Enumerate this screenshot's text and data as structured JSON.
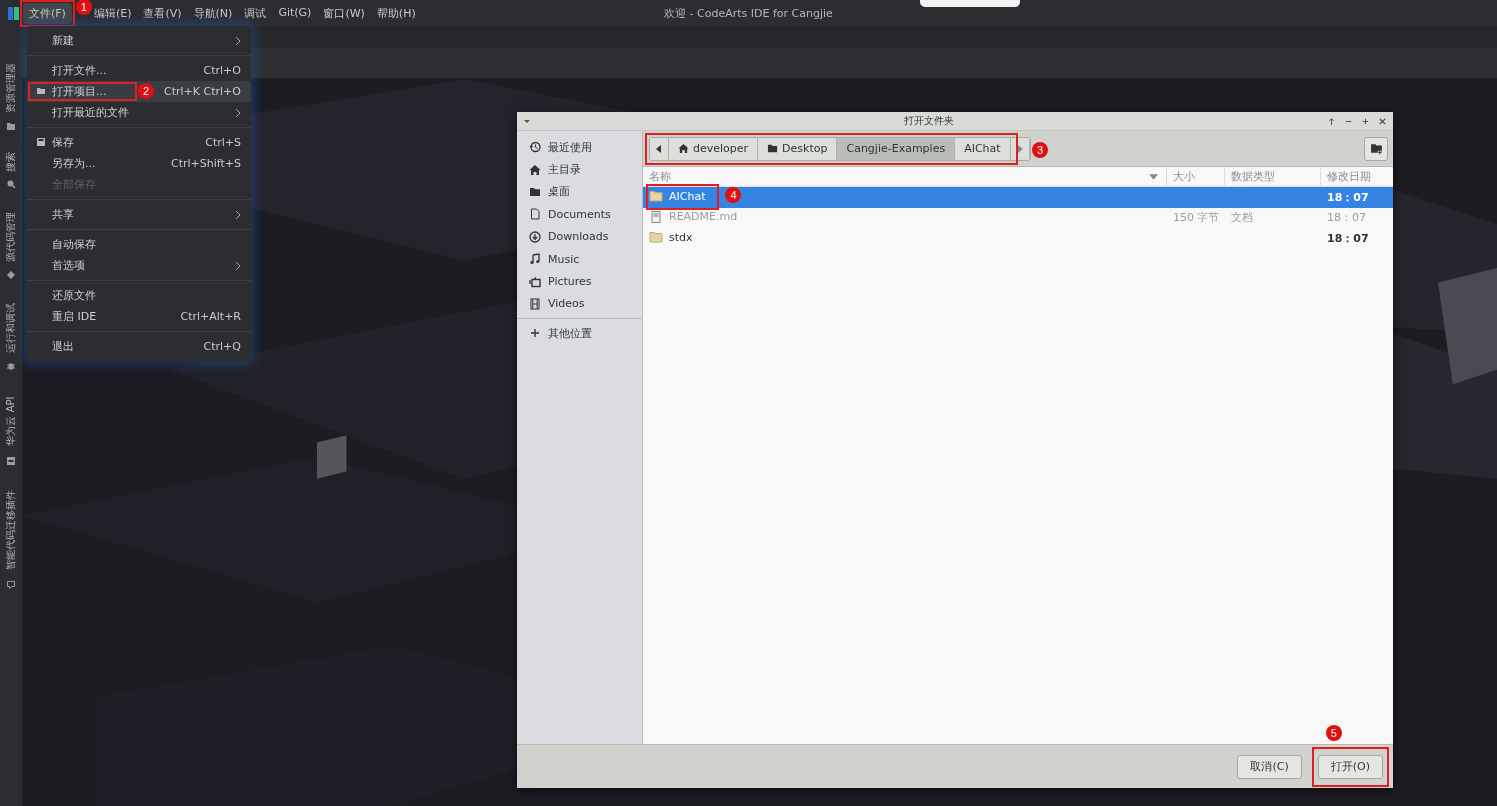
{
  "title_bar": {
    "title": "欢迎 - CodeArts IDE for Cangjie"
  },
  "menu_bar": [
    {
      "label": "文件(F)",
      "selected": true,
      "marker": "1"
    },
    {
      "label": "编辑(E)",
      "selected": false
    },
    {
      "label": "查看(V)",
      "selected": false
    },
    {
      "label": "导航(N)",
      "selected": false
    },
    {
      "label": "调试",
      "selected": false
    },
    {
      "label": "Git(G)",
      "selected": false
    },
    {
      "label": "窗口(W)",
      "selected": false
    },
    {
      "label": "帮助(H)",
      "selected": false
    }
  ],
  "activity_bar": [
    {
      "kind": "explorer",
      "label": "资源管理器"
    },
    {
      "kind": "search",
      "label": "搜索"
    },
    {
      "kind": "source",
      "label": "源代码管理"
    },
    {
      "kind": "debug",
      "label": "运行和调试"
    },
    {
      "kind": "api",
      "label": "华为云 API"
    },
    {
      "kind": "migrate",
      "label": "智能代码迁移插件"
    }
  ],
  "file_menu": [
    {
      "kind": "plain",
      "label": "新建",
      "submenu": true,
      "disabled": false,
      "selected": false
    },
    {
      "kind": "separator"
    },
    {
      "kind": "plain",
      "label": "打开文件...",
      "shortcut": "Ctrl+O",
      "submenu": false,
      "disabled": false,
      "selected": false
    },
    {
      "kind": "folder",
      "label": "打开项目...",
      "shortcut": "Ctrl+K Ctrl+O",
      "submenu": false,
      "disabled": false,
      "selected": true,
      "marker": "2"
    },
    {
      "kind": "plain",
      "label": "打开最近的文件",
      "submenu": true,
      "disabled": false,
      "selected": false
    },
    {
      "kind": "separator"
    },
    {
      "kind": "save",
      "label": "保存",
      "shortcut": "Ctrl+S",
      "submenu": false,
      "disabled": false,
      "selected": false
    },
    {
      "kind": "plain",
      "label": "另存为...",
      "shortcut": "Ctrl+Shift+S",
      "submenu": false,
      "disabled": false,
      "selected": false
    },
    {
      "kind": "plain",
      "label": "全部保存",
      "submenu": false,
      "disabled": true,
      "selected": false
    },
    {
      "kind": "separator"
    },
    {
      "kind": "plain",
      "label": "共享",
      "submenu": true,
      "disabled": false,
      "selected": false
    },
    {
      "kind": "separator"
    },
    {
      "kind": "plain",
      "label": "自动保存",
      "submenu": false,
      "disabled": false,
      "selected": false
    },
    {
      "kind": "plain",
      "label": "首选项",
      "submenu": true,
      "disabled": false,
      "selected": false
    },
    {
      "kind": "separator"
    },
    {
      "kind": "plain",
      "label": "还原文件",
      "submenu": false,
      "disabled": false,
      "selected": false
    },
    {
      "kind": "plain",
      "label": "重启 IDE",
      "shortcut": "Ctrl+Alt+R",
      "submenu": false,
      "disabled": false,
      "selected": false
    },
    {
      "kind": "separator"
    },
    {
      "kind": "plain",
      "label": "退出",
      "shortcut": "Ctrl+Q",
      "submenu": false,
      "disabled": false,
      "selected": false
    }
  ],
  "dialog": {
    "title": "打开文件夹",
    "places": [
      {
        "kind": "recent",
        "label": "最近使用"
      },
      {
        "kind": "home",
        "label": "主目录"
      },
      {
        "kind": "desktop",
        "label": "桌面"
      },
      {
        "kind": "documents",
        "label": "Documents"
      },
      {
        "kind": "downloads",
        "label": "Downloads"
      },
      {
        "kind": "music",
        "label": "Music"
      },
      {
        "kind": "pictures",
        "label": "Pictures"
      },
      {
        "kind": "videos",
        "label": "Videos"
      },
      {
        "kind": "other",
        "label": "其他位置"
      }
    ],
    "path_marker": "3",
    "path": [
      {
        "kind": "home",
        "label": "developer",
        "selected": false
      },
      {
        "kind": "folder",
        "label": "Desktop",
        "selected": false
      },
      {
        "kind": "plain",
        "label": "Cangjie-Examples",
        "selected": true
      },
      {
        "kind": "plain",
        "label": "AIChat",
        "selected": false
      }
    ],
    "columns": [
      "名称",
      "大小",
      "数据类型",
      "修改日期"
    ],
    "files": [
      {
        "kind": "folder",
        "name": "AIChat",
        "modified": "18：07",
        "selected": true,
        "disabled": false,
        "marker": "4"
      },
      {
        "kind": "file",
        "name": "README.md",
        "size": "150 字节",
        "type": "文档",
        "modified": "18：07",
        "selected": false,
        "disabled": true
      },
      {
        "kind": "folder",
        "name": "stdx",
        "modified": "18：07",
        "selected": false,
        "disabled": false
      }
    ],
    "buttons": [
      {
        "label": "取消(C)"
      },
      {
        "label": "打开(O)",
        "marker": "5"
      }
    ]
  }
}
